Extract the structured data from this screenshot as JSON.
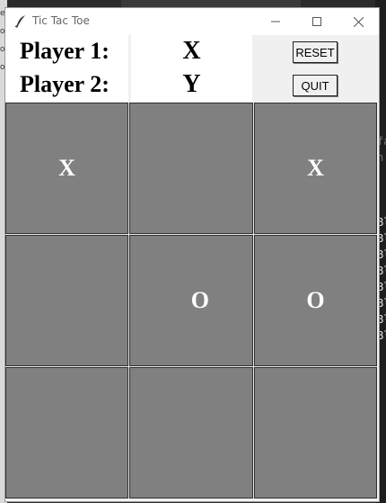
{
  "window": {
    "title": "Tic Tac Toe"
  },
  "background": {
    "left_lines": [
      "e",
      "ot",
      "ot",
      "ot"
    ],
    "right_lines": [
      "fa",
      "n",
      "Bl",
      "Bl",
      "Bl",
      "Bl",
      "Bl",
      "Bl",
      "Bl",
      "Bl"
    ]
  },
  "players": {
    "p1_label": "Player 1:",
    "p1_symbol": "X",
    "p2_label": "Player 2:",
    "p2_symbol": "Y"
  },
  "controls": {
    "reset_label": "RESET",
    "quit_label": "QUIT"
  },
  "board": [
    [
      "X",
      "",
      "X"
    ],
    [
      "",
      "O",
      "O"
    ],
    [
      "",
      "",
      ""
    ]
  ],
  "colors": {
    "cell": "#808080",
    "mark": "#ffffff"
  }
}
